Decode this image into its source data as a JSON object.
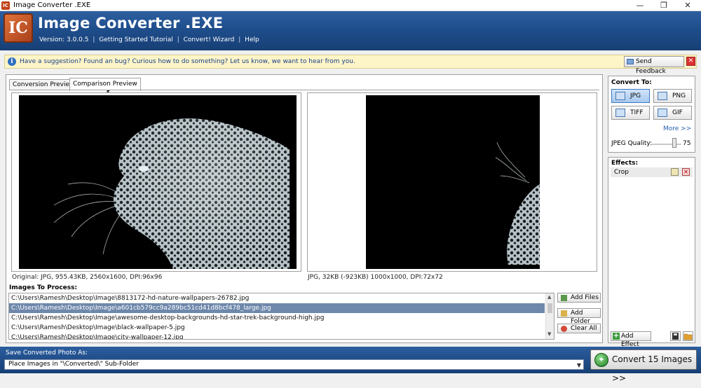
{
  "window": {
    "title": "Image Converter .EXE",
    "icon_text": "IC",
    "buttons": [
      "—",
      "❐",
      "✕"
    ]
  },
  "header": {
    "logo_text": "IC",
    "app_name": "Image Converter .EXE",
    "version": "Version: 3.0.0.5",
    "links": [
      "Getting Started Tutorial",
      "Convert! Wizard",
      "Help"
    ],
    "separator": "|"
  },
  "suggestion_bar": {
    "text": "Have a suggestion? Found an bug? Curious how to do something? Let us know, we want to hear from you.",
    "feedback_button": "Send Feedback"
  },
  "tabs": [
    "Conversion Preview",
    "Comparison Preview"
  ],
  "active_tab": "Comparison Preview",
  "preview": {
    "original_caption": "Original: JPG, 955.43KB, 2560x1600, DPI:96x96",
    "converted_caption": "JPG, 32KB (-923KB) 1000x1000, DPI:72x72"
  },
  "images_to_process": {
    "label": "Images To Process:",
    "files": [
      "C:\\Users\\Ramesh\\Desktop\\Image\\8813172-hd-nature-wallpapers-26782.jpg",
      "C:\\Users\\Ramesh\\Desktop\\Image\\a601cb579cc9a289bc51cd41d8bcf478_large.jpg",
      "C:\\Users\\Ramesh\\Desktop\\Image\\awesome-desktop-backgrounds-hd-star-trek-background-high.jpg",
      "C:\\Users\\Ramesh\\Desktop\\Image\\black-wallpaper-5.jpg",
      "C:\\Users\\Ramesh\\Desktop\\Image\\city-wallpaper-12.jpg"
    ],
    "selected_index": 1,
    "buttons": {
      "add_files": "Add Files",
      "add_folder": "Add Folder",
      "clear_all": "Clear All"
    }
  },
  "convert_to": {
    "label": "Convert To:",
    "formats": [
      "JPG",
      "PNG",
      "TIFF",
      "GIF"
    ],
    "selected": "JPG",
    "more": "More >>",
    "quality_label": "JPEG Quality:",
    "quality_value": "75",
    "quality_fraction": 0.75
  },
  "effects": {
    "label": "Effects:",
    "items": [
      "Crop"
    ],
    "add_button": "Add Effect"
  },
  "save": {
    "label": "Save Converted Photo As:",
    "selected": "Place Images in \"\\Converted\\\" Sub-Folder",
    "convert_button": "Convert 15 Images >>"
  },
  "colors": {
    "header_blue": "#1f4e8c",
    "selection": "#6e88ab",
    "suggest_bg": "#fdf5c8"
  }
}
